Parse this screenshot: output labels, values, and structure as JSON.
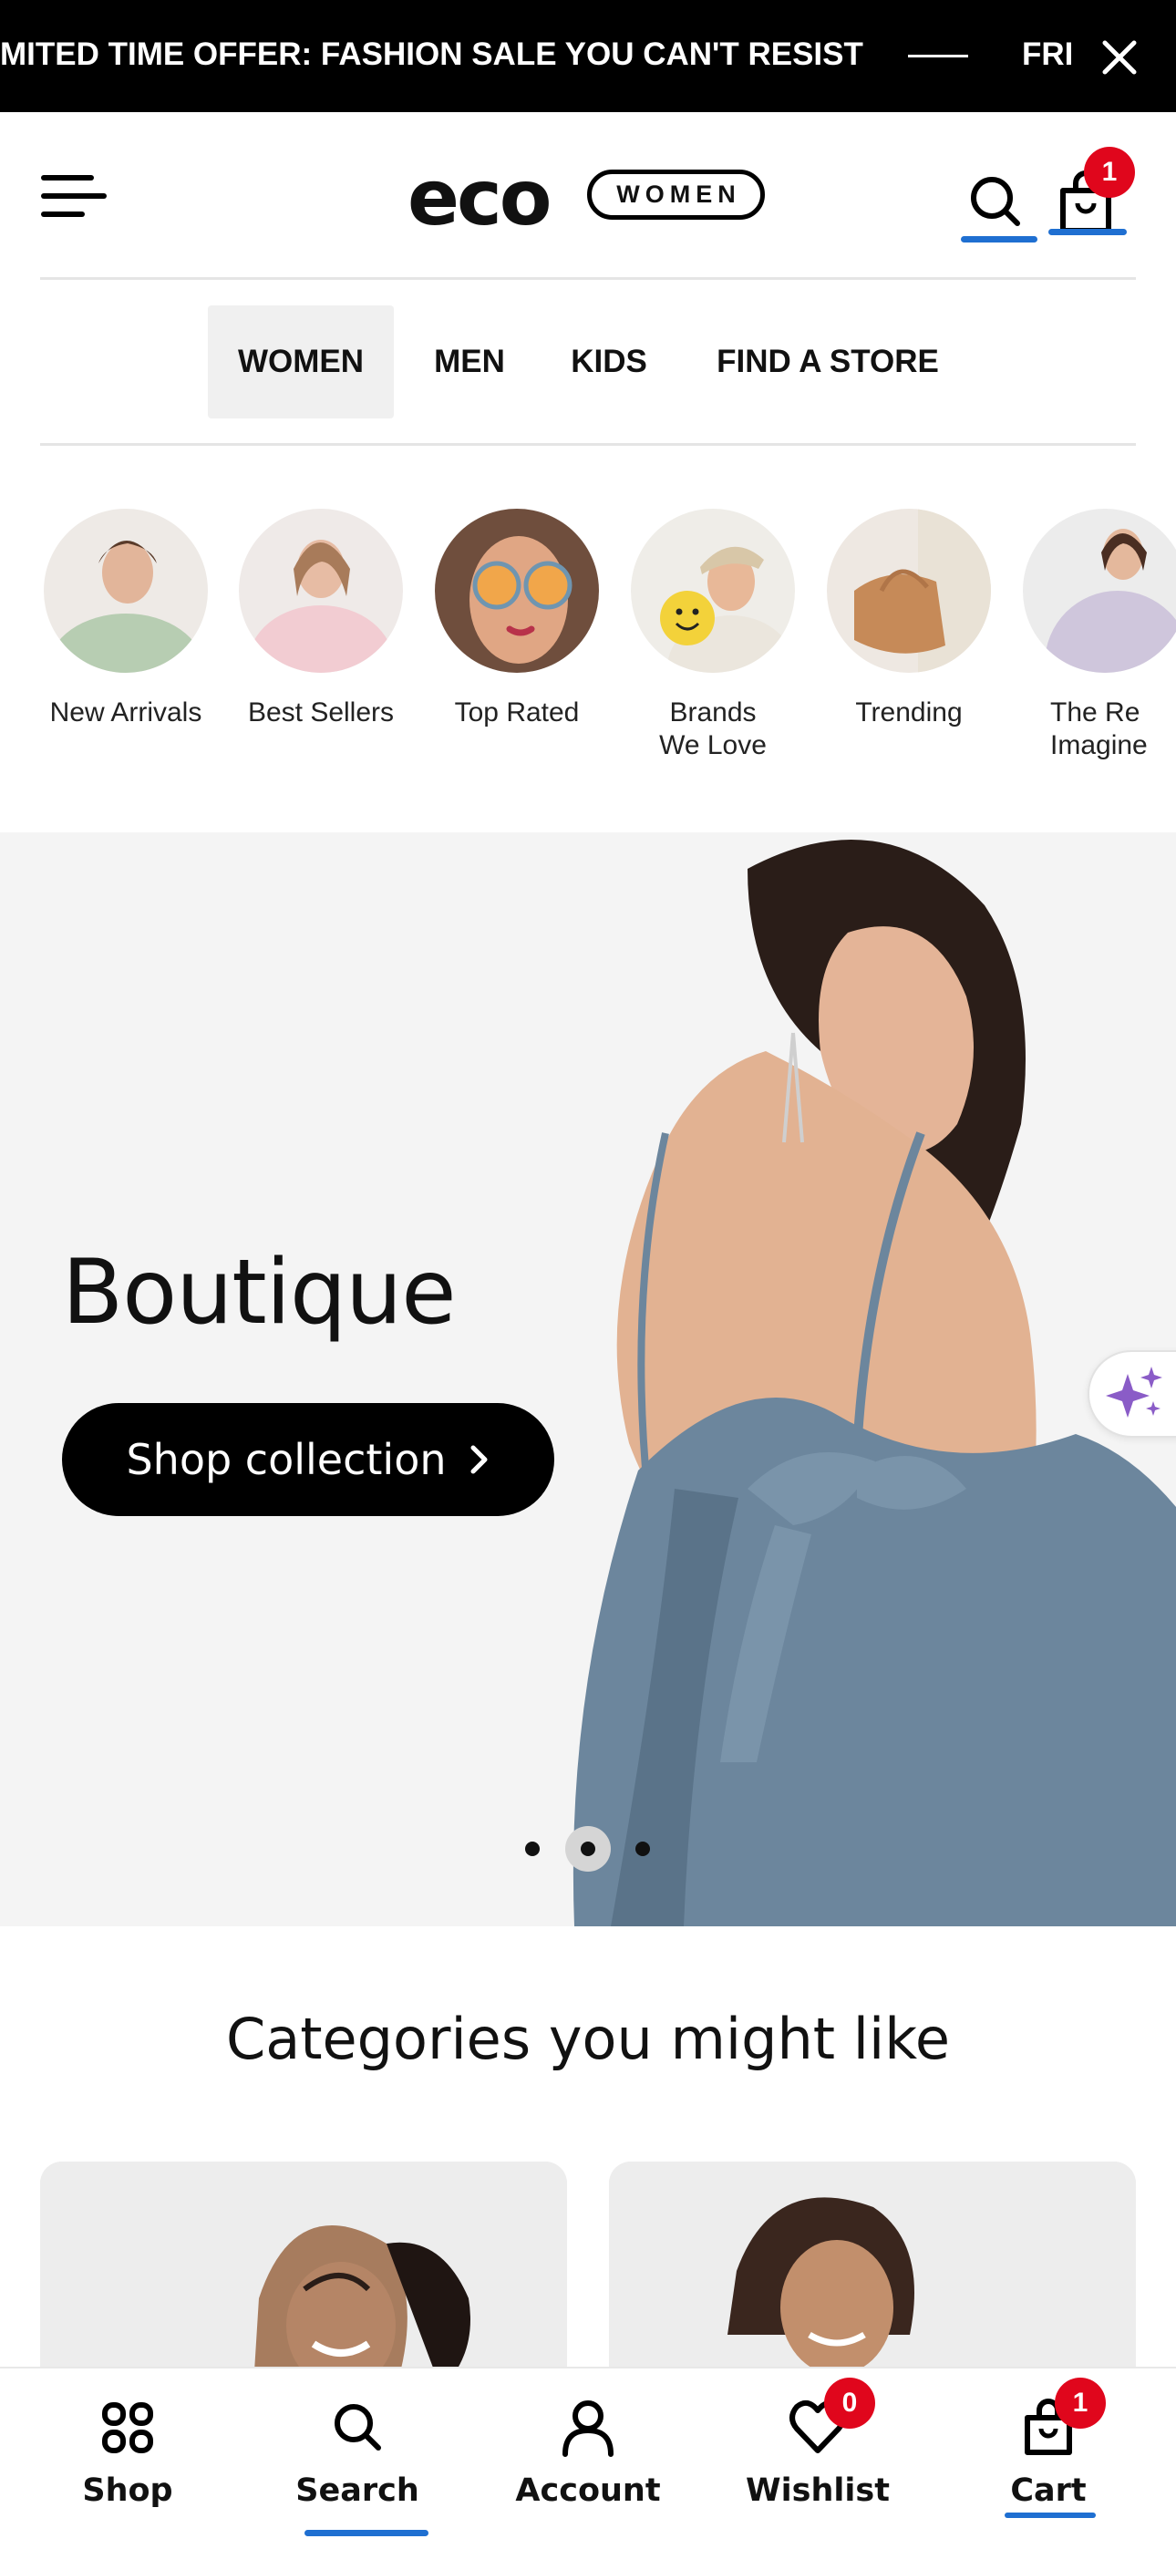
{
  "promo": {
    "text": "MITED TIME OFFER: FASHION SALE YOU CAN'T RESIST",
    "next_text": "FRI"
  },
  "header": {
    "logo_word": "eco",
    "logo_tag": "WOMEN",
    "cart_count": "1"
  },
  "nav": {
    "tabs": [
      {
        "label": "WOMEN",
        "active": true
      },
      {
        "label": "MEN"
      },
      {
        "label": "KIDS"
      },
      {
        "label": "FIND A STORE"
      }
    ]
  },
  "stories": [
    {
      "label": "New Arrivals",
      "bg": "#b9cdb1",
      "accent": "#a7c4a0"
    },
    {
      "label": "Best Sellers",
      "bg": "#eedbdc",
      "accent": "#f1c6cc"
    },
    {
      "label": "Top Rated",
      "bg": "#9a7460",
      "accent": "#f0a64a"
    },
    {
      "label": "Brands We Love",
      "bg": "#f2f0ea",
      "accent": "#f4d23c"
    },
    {
      "label": "Trending",
      "bg": "#efe9e3",
      "accent": "#c98f5c"
    },
    {
      "label": "The Re Imagine",
      "bg": "#d6d0dc",
      "accent": "#b9b0c8"
    }
  ],
  "hero": {
    "title": "Boutique",
    "cta": "Shop collection"
  },
  "categories": {
    "title": "Categories you might like"
  },
  "tabbar": {
    "tabs": [
      {
        "label": "Shop",
        "icon": "grid-icon"
      },
      {
        "label": "Search",
        "icon": "search-icon"
      },
      {
        "label": "Account",
        "icon": "person-icon"
      },
      {
        "label": "Wishlist",
        "icon": "heart-icon",
        "badge": "0"
      },
      {
        "label": "Cart",
        "icon": "bag-icon",
        "badge": "1"
      }
    ]
  },
  "colors": {
    "accent_blue": "#1f6fd1",
    "badge_red": "#e0061c",
    "ai_purple": "#8a5cc7"
  }
}
